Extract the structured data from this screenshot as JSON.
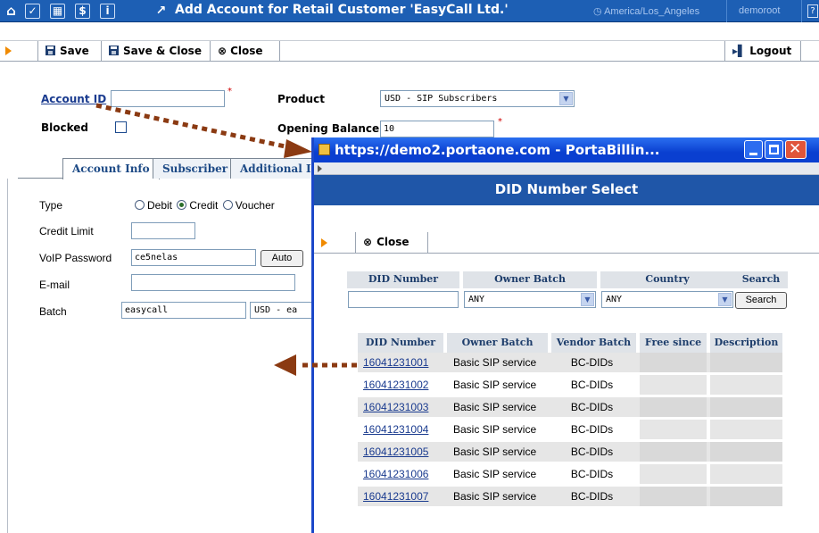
{
  "titlebar": {
    "title": "Add Account for Retail Customer 'EasyCall Ltd.'",
    "timezone": "America/Los_Angeles",
    "user": "demoroot",
    "icons": [
      "home-icon",
      "check-icon",
      "grid-icon",
      "dollar-icon",
      "info-icon",
      "chart-icon"
    ]
  },
  "toolbar": {
    "save_label": "Save",
    "save_close_label": "Save & Close",
    "close_label": "Close",
    "logout_label": "Logout"
  },
  "form": {
    "account_id_label": "Account ID",
    "account_id_value": "",
    "blocked_label": "Blocked",
    "product_label": "Product",
    "product_value": "USD - SIP Subscribers",
    "opening_balance_label": "Opening Balance",
    "opening_balance_value": "10"
  },
  "tabs": [
    "Account Info",
    "Subscriber",
    "Additional In"
  ],
  "account_info": {
    "type_label": "Type",
    "type_options": [
      "Debit",
      "Credit",
      "Voucher"
    ],
    "type_selected": "Credit",
    "credit_limit_label": "Credit Limit",
    "credit_limit_value": "",
    "voip_password_label": "VoIP Password",
    "voip_password_value": "ce5nelas",
    "auto_button": "Auto",
    "email_label": "E-mail",
    "email_value": "",
    "batch_label": "Batch",
    "batch_value": "easycall",
    "batch_currency": "USD - ea"
  },
  "popup": {
    "window_title": "https://demo2.portaone.com - PortaBillin...",
    "heading": "DID Number Select",
    "close_label": "Close",
    "search": {
      "did_number_label": "DID Number",
      "did_number_value": "",
      "owner_batch_label": "Owner Batch",
      "owner_batch_value": "ANY",
      "country_label": "Country",
      "country_value": "ANY",
      "search_label": "Search",
      "search_button": "Search"
    },
    "columns": [
      "DID Number",
      "Owner Batch",
      "Vendor Batch",
      "Free since",
      "Description"
    ],
    "rows": [
      {
        "did": "16041231001",
        "owner": "Basic SIP service",
        "vendor": "BC-DIDs",
        "free_since": "",
        "description": ""
      },
      {
        "did": "16041231002",
        "owner": "Basic SIP service",
        "vendor": "BC-DIDs",
        "free_since": "",
        "description": ""
      },
      {
        "did": "16041231003",
        "owner": "Basic SIP service",
        "vendor": "BC-DIDs",
        "free_since": "",
        "description": ""
      },
      {
        "did": "16041231004",
        "owner": "Basic SIP service",
        "vendor": "BC-DIDs",
        "free_since": "",
        "description": ""
      },
      {
        "did": "16041231005",
        "owner": "Basic SIP service",
        "vendor": "BC-DIDs",
        "free_since": "",
        "description": ""
      },
      {
        "did": "16041231006",
        "owner": "Basic SIP service",
        "vendor": "BC-DIDs",
        "free_since": "",
        "description": ""
      },
      {
        "did": "16041231007",
        "owner": "Basic SIP service",
        "vendor": "BC-DIDs",
        "free_since": "",
        "description": ""
      }
    ]
  },
  "colors": {
    "titlebar": "#1d5fb4",
    "popup_heading": "#1f56a8",
    "arrow": "#8b3a12",
    "toolbar_play": "#f08a00"
  }
}
